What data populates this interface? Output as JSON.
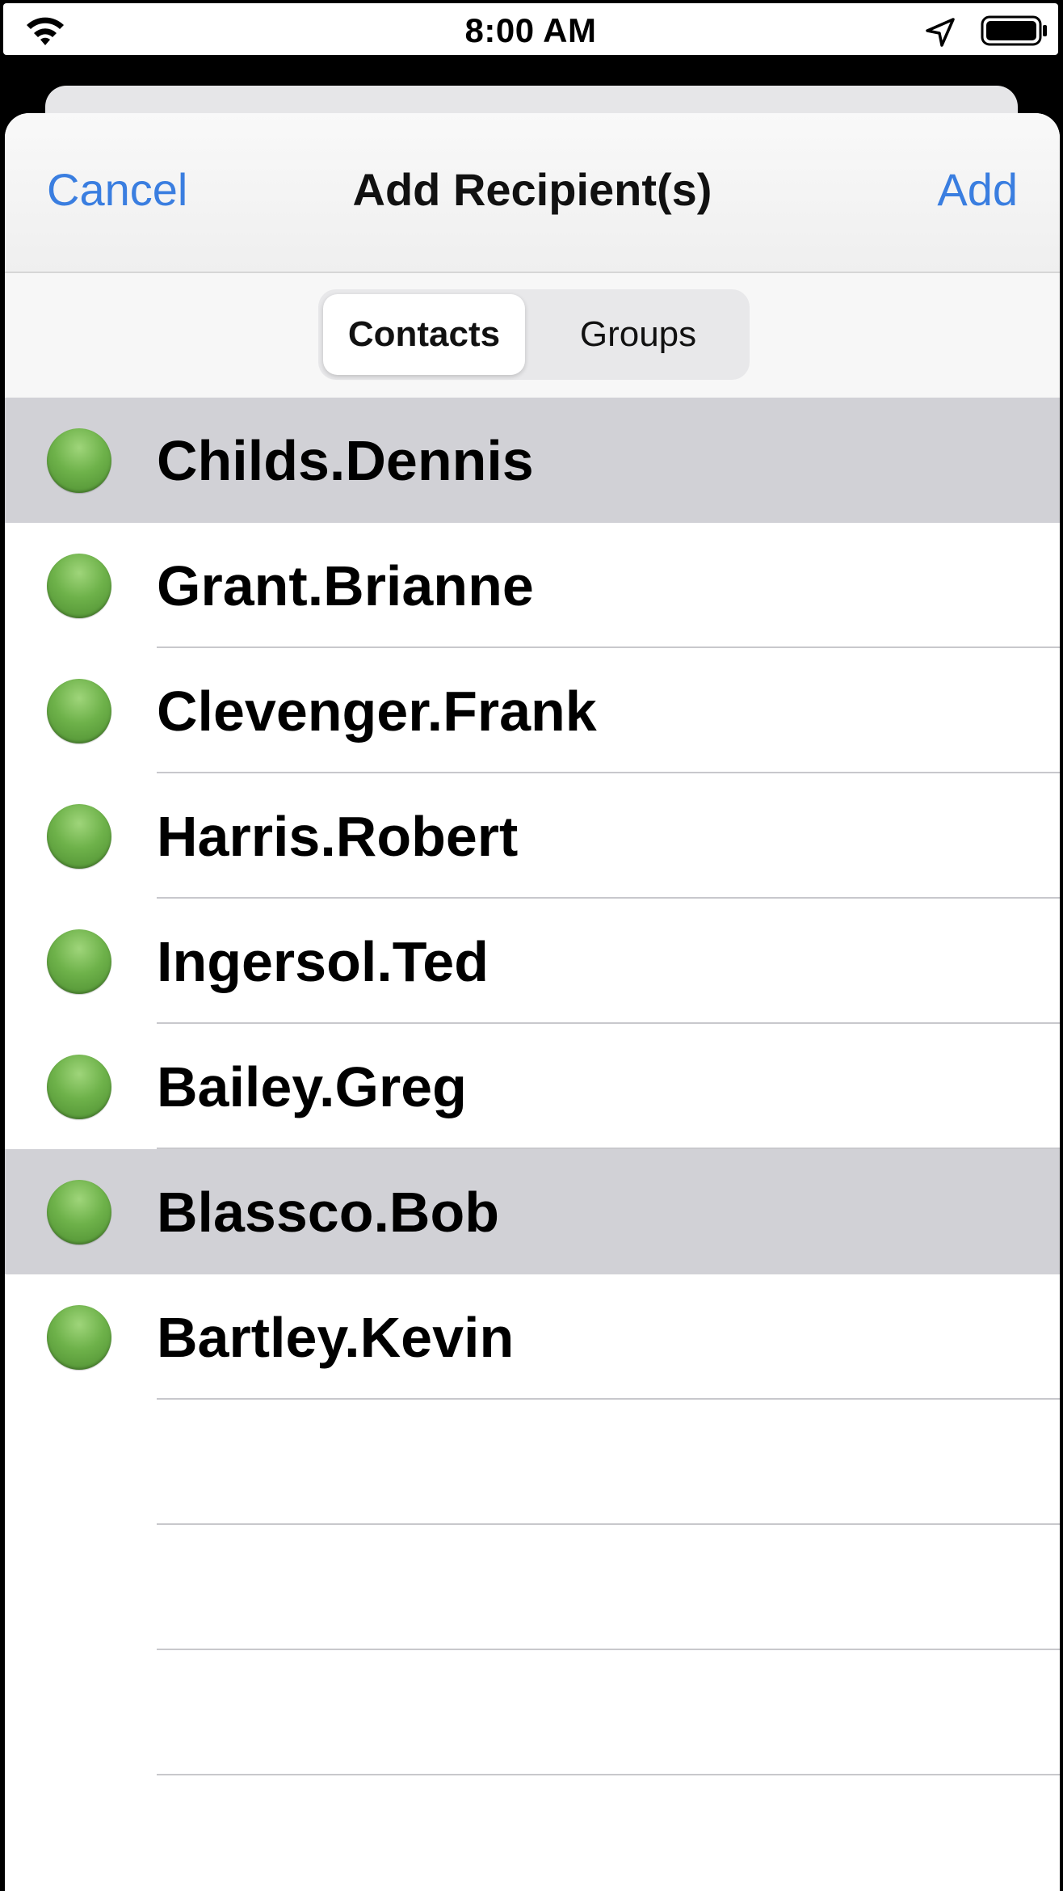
{
  "status_bar": {
    "time": "8:00 AM"
  },
  "nav": {
    "cancel_label": "Cancel",
    "title": "Add Recipient(s)",
    "add_label": "Add"
  },
  "segments": {
    "contacts_label": "Contacts",
    "groups_label": "Groups",
    "selected": "Contacts"
  },
  "contacts": [
    {
      "name": "Childs.Dennis",
      "selected": true,
      "status_color": "#5fa63e"
    },
    {
      "name": "Grant.Brianne",
      "selected": false,
      "status_color": "#5fa63e"
    },
    {
      "name": "Clevenger.Frank",
      "selected": false,
      "status_color": "#5fa63e"
    },
    {
      "name": "Harris.Robert",
      "selected": false,
      "status_color": "#5fa63e"
    },
    {
      "name": "Ingersol.Ted",
      "selected": false,
      "status_color": "#5fa63e"
    },
    {
      "name": "Bailey.Greg",
      "selected": false,
      "status_color": "#5fa63e"
    },
    {
      "name": "Blassco.Bob",
      "selected": true,
      "status_color": "#5fa63e"
    },
    {
      "name": "Bartley.Kevin",
      "selected": false,
      "status_color": "#5fa63e"
    }
  ],
  "colors": {
    "accent": "#3a7ee0",
    "selected_row": "#d1d1d6",
    "status_online": "#5fa63e"
  },
  "icons": {
    "wifi": "wifi-icon",
    "location": "location-arrow-icon",
    "battery": "battery-icon"
  }
}
